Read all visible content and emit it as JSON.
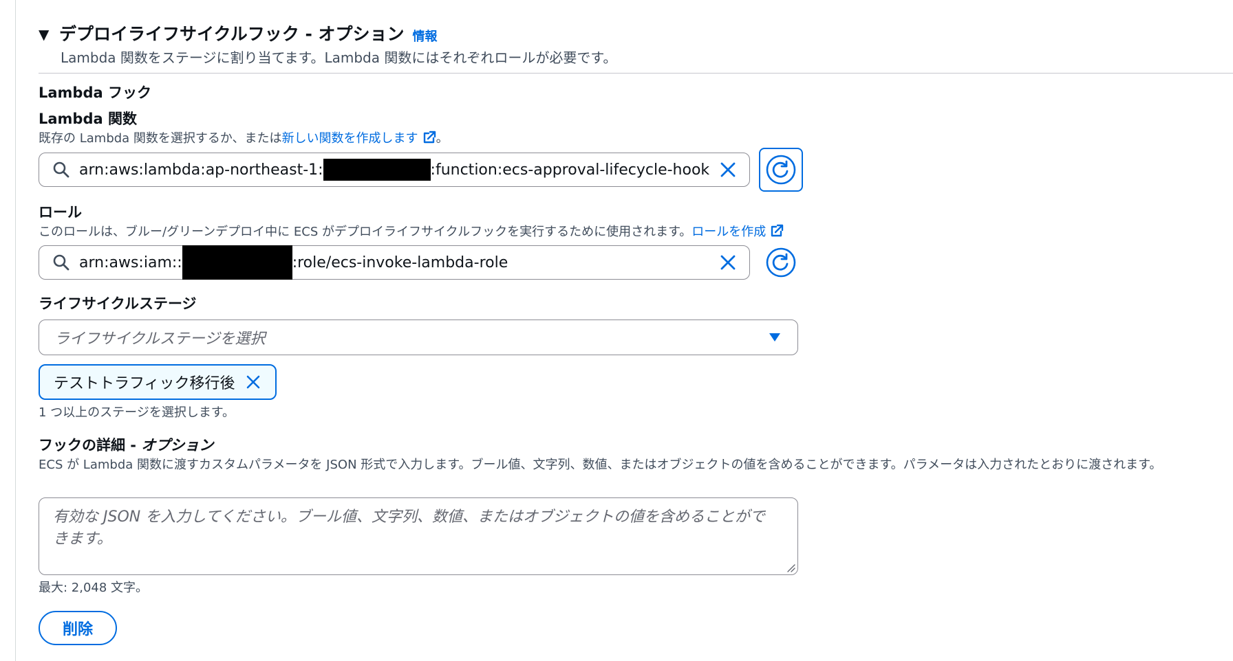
{
  "section": {
    "caret": "▼",
    "title": "デプロイライフサイクルフック - オプション",
    "info_link": "情報",
    "description": "Lambda 関数をステージに割り当てます。Lambda 関数にはそれぞれロールが必要です。"
  },
  "lambda_hook": {
    "heading": "Lambda フック"
  },
  "lambda_function": {
    "label": "Lambda 関数",
    "description_prefix": "既存の Lambda 関数を選択するか、または",
    "description_link": "新しい関数を作成します",
    "description_suffix": "。",
    "value_prefix": "arn:aws:lambda:ap-northeast-1:",
    "value_suffix": ":function:ecs-approval-lifecycle-hook",
    "icons": {
      "search": "search-icon",
      "clear": "close-icon",
      "refresh": "refresh-icon",
      "external": "external-link-icon"
    }
  },
  "role": {
    "label": "ロール",
    "description": "このロールは、ブルー/グリーンデプロイ中に ECS がデプロイライフサイクルフックを実行するために使用されます。",
    "description_link": "ロールを作成",
    "value_prefix": "arn:aws:iam::",
    "value_suffix": ":role/ecs-invoke-lambda-role"
  },
  "lifecycle_stage": {
    "label": "ライフサイクルステージ",
    "placeholder": "ライフサイクルステージを選択",
    "selected_tokens": [
      "テストトラフィック移行後"
    ],
    "hint": "1 つ以上のステージを選択します。"
  },
  "hook_details": {
    "label_main": "フックの詳細 - ",
    "label_optional": "オプション",
    "description": "ECS が Lambda 関数に渡すカスタムパラメータを JSON 形式で入力します。ブール値、文字列、数値、またはオブジェクトの値を含めることができます。パラメータは入力されたとおりに渡されます。",
    "placeholder": "有効な JSON を入力してください。ブール値、文字列、数値、またはオブジェクトの値を含めることができます。",
    "constraint": "最大: 2,048 文字。"
  },
  "actions": {
    "delete_label": "削除"
  },
  "colors": {
    "link": "#006ce0",
    "text": "#0f141a",
    "secondary_text": "#414d5c",
    "border": "#8c8c94",
    "token_bg": "#f0fbff"
  }
}
